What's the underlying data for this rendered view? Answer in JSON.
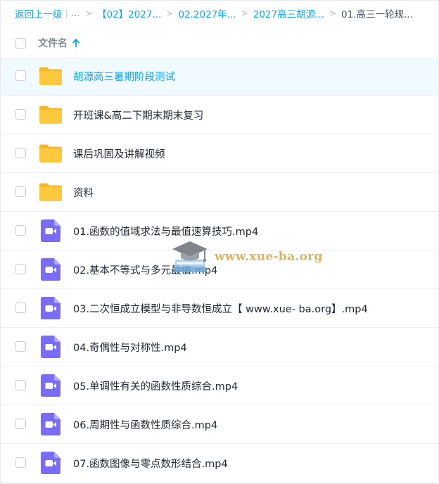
{
  "breadcrumb": {
    "back": "返回上一级",
    "pipe": "|",
    "ellipsis": "...",
    "sep": ">",
    "items": [
      "【02】2027...",
      "02.2027年...",
      "2027高三胡源..."
    ],
    "current": "01.高三一轮规..."
  },
  "header": {
    "name_label": "文件名",
    "sort": "arrow-up-icon"
  },
  "files": [
    {
      "type": "folder",
      "name": "胡源高三暑期阶段测试",
      "selected": true
    },
    {
      "type": "folder",
      "name": "开班课&高二下期末期末复习",
      "selected": false
    },
    {
      "type": "folder",
      "name": "课后巩固及讲解视频",
      "selected": false
    },
    {
      "type": "folder",
      "name": "资料",
      "selected": false
    },
    {
      "type": "video",
      "name": "01.函数的值域求法与最值速算技巧.mp4",
      "selected": false
    },
    {
      "type": "video",
      "name": "02.基本不等式与多元最值.mp4",
      "selected": false
    },
    {
      "type": "video",
      "name": "03.二次恒成立模型与非导数恒成立【 www.xue- ba.org】.mp4",
      "selected": false
    },
    {
      "type": "video",
      "name": "04.奇偶性与对称性.mp4",
      "selected": false
    },
    {
      "type": "video",
      "name": "05.单调性有关的函数性质综合.mp4",
      "selected": false
    },
    {
      "type": "video",
      "name": "06.周期性与函数性质综合.mp4",
      "selected": false
    },
    {
      "type": "video",
      "name": "07.函数图像与零点数形结合.mp4",
      "selected": false
    }
  ],
  "watermark": {
    "text": "www.xue-ba.org"
  },
  "colors": {
    "accent": "#06a7ff",
    "folder": "#ffc83d",
    "video": "#7b6cf6",
    "selected_bg": "#f0faff"
  }
}
